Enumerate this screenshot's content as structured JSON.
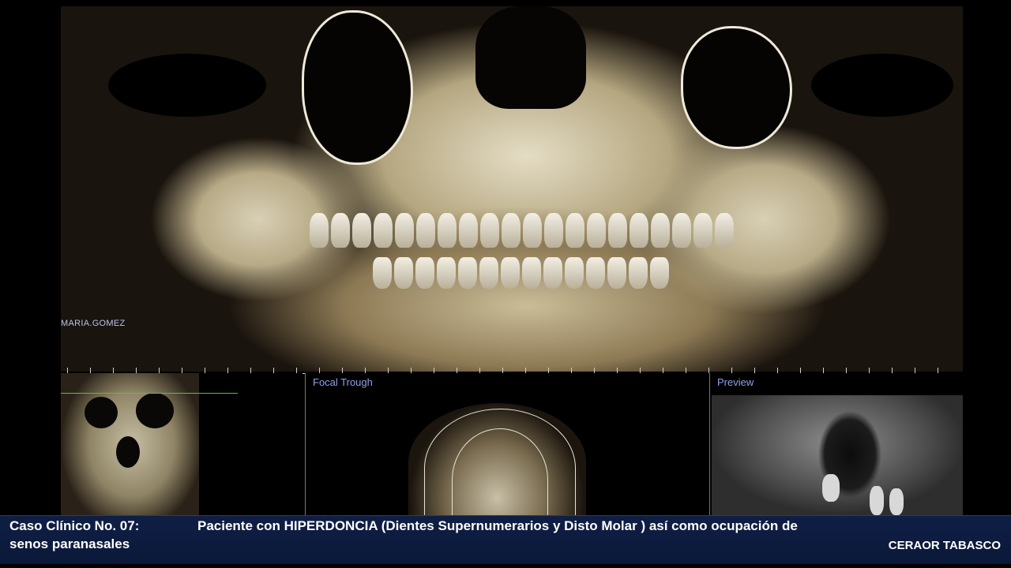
{
  "viewer": {
    "watermark": "MARIA.GOMEZ",
    "panels": {
      "focal_trough_title": "Focal Trough",
      "preview_title": "Preview"
    }
  },
  "caption": {
    "case_label": "Caso Clínico No. 07:",
    "description": "Paciente con HIPERDONCIA (Dientes Supernumerarios y Disto Molar ) así como ocupación de",
    "description_cont": "senos paranasales",
    "credit": "CERAOR TABASCO"
  },
  "colors": {
    "caption_bg": "#0f1f45",
    "panel_title": "#8da0e6",
    "reference_line": "#3bd13b"
  }
}
